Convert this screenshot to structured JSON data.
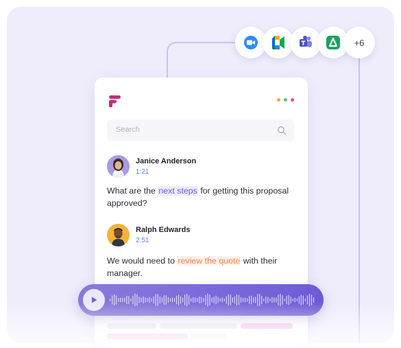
{
  "integrations": {
    "items": [
      {
        "name": "zoom",
        "color": "#2d8cff"
      },
      {
        "name": "google-meet",
        "color": "#00ac47"
      },
      {
        "name": "microsoft-teams",
        "color": "#5059c9"
      },
      {
        "name": "webex-like",
        "color": "#1aa260"
      }
    ],
    "more_label": "+6"
  },
  "card": {
    "menu_dots": [
      "#f4a340",
      "#5cc48a",
      "#ea4c89"
    ],
    "search": {
      "placeholder": "Search"
    },
    "messages": [
      {
        "name": "Janice Anderson",
        "time": "1:21",
        "text_parts": [
          {
            "text": "What are the ",
            "highlight": "none"
          },
          {
            "text": "next steps",
            "highlight": "blue"
          },
          {
            "text": " for getting this proposal approved?",
            "highlight": "none"
          }
        ]
      },
      {
        "name": "Ralph Edwards",
        "time": "2:51",
        "text_parts": [
          {
            "text": "We would need to ",
            "highlight": "none"
          },
          {
            "text": "review the quote",
            "highlight": "orange"
          },
          {
            "text": " with their manager.",
            "highlight": "none"
          }
        ]
      }
    ]
  },
  "player": {
    "play_icon": "play-icon",
    "accent_color": "#7b6adb"
  },
  "colors": {
    "background": "#efecfb",
    "connector": "#c9c2ef",
    "highlight_blue": "#6b5cf0",
    "highlight_orange": "#ef8455"
  }
}
